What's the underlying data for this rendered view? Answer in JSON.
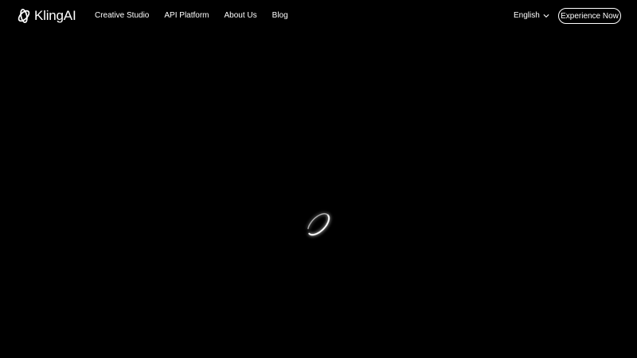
{
  "header": {
    "logo_text": "KlingAI",
    "logo_icon": "kling-logo-icon",
    "nav_items": [
      {
        "label": "Creative Studio"
      },
      {
        "label": "API Platform"
      },
      {
        "label": "About Us"
      },
      {
        "label": "Blog"
      }
    ],
    "language": {
      "label": "English",
      "icon": "chevron-down-icon"
    },
    "cta_label": "Experience Now"
  },
  "main": {
    "loader_icon": "loading-ring-icon"
  },
  "colors": {
    "background": "#000000",
    "foreground": "#ffffff"
  }
}
